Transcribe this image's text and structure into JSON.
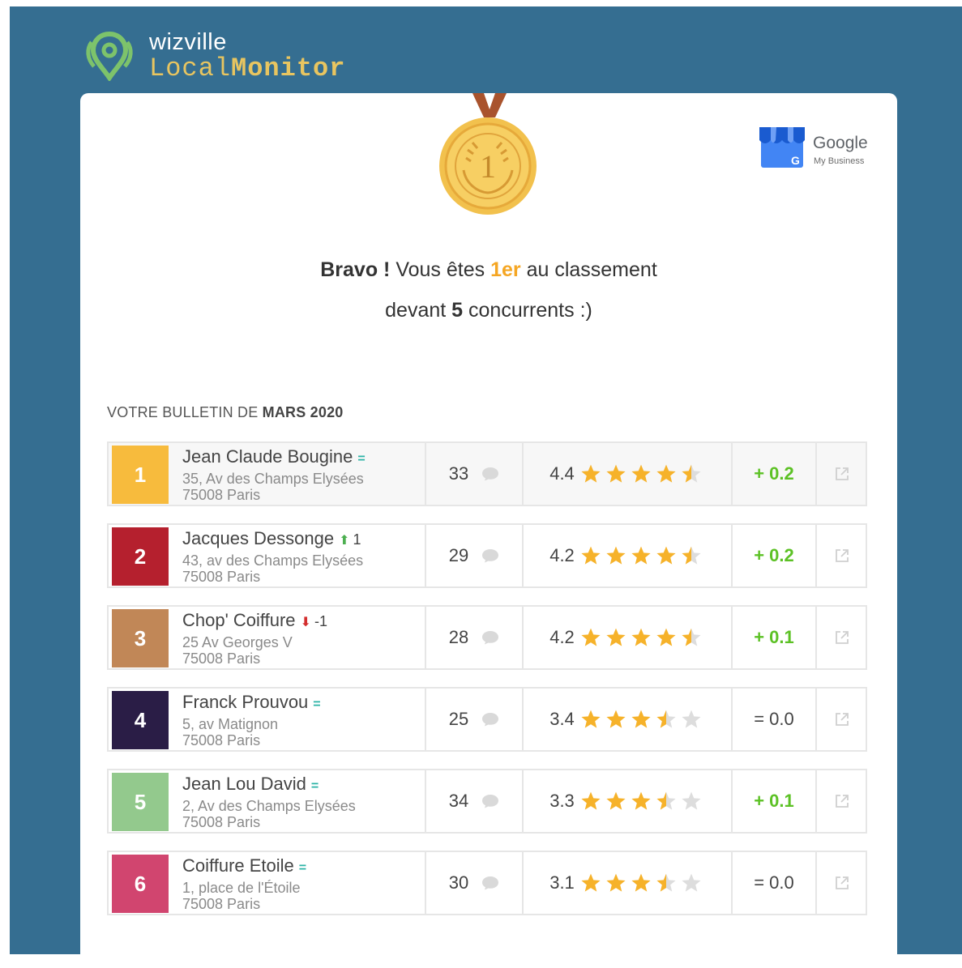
{
  "brand": {
    "top": "wizville",
    "bottom_light": "Local",
    "bottom_bold": "Monitor"
  },
  "gmb": {
    "word": "Google",
    "sub": "My Business"
  },
  "medal": {
    "number": "1"
  },
  "headline": {
    "line1_bold": "Bravo !",
    "line1_mid": " Vous êtes ",
    "line1_rank": "1er",
    "line1_end": " au classement",
    "line2_start": "devant ",
    "line2_count": "5",
    "line2_end": " concurrents :)"
  },
  "bulletin": {
    "prefix": "VOTRE BULLETIN DE ",
    "period": "MARS 2020"
  },
  "colors": {
    "frame": "#356e91",
    "gold": "#f5a623",
    "positive": "#5cc125",
    "star": "#f6b22a"
  },
  "rows": [
    {
      "rank": "1",
      "color": "#f7bb3d",
      "name": "Jean Claude Bougine",
      "trend_symbol": "=",
      "trend_kind": "eq",
      "trend_value": "",
      "addr1": "35, Av des Champs Elysées",
      "addr2": "75008 Paris",
      "reviews": "33",
      "rating": "4.4",
      "stars": 4.5,
      "delta": "+ 0.2",
      "delta_kind": "pos"
    },
    {
      "rank": "2",
      "color": "#b5202e",
      "name": "Jacques Dessonge",
      "trend_symbol": "⬆",
      "trend_kind": "up",
      "trend_value": "1",
      "addr1": "43, av des Champs Elysées",
      "addr2": "75008 Paris",
      "reviews": "29",
      "rating": "4.2",
      "stars": 4.5,
      "delta": "+ 0.2",
      "delta_kind": "pos"
    },
    {
      "rank": "3",
      "color": "#c18757",
      "name": "Chop' Coiffure",
      "trend_symbol": "⬇",
      "trend_kind": "down",
      "trend_value": "-1",
      "addr1": "25 Av Georges V",
      "addr2": "75008 Paris",
      "reviews": "28",
      "rating": "4.2",
      "stars": 4.5,
      "delta": "+ 0.1",
      "delta_kind": "pos"
    },
    {
      "rank": "4",
      "color": "#2a1d46",
      "name": "Franck Prouvou",
      "trend_symbol": "=",
      "trend_kind": "eq",
      "trend_value": "",
      "addr1": "5, av Matignon",
      "addr2": "75008 Paris",
      "reviews": "25",
      "rating": "3.4",
      "stars": 3.5,
      "delta": "= 0.0",
      "delta_kind": "zero"
    },
    {
      "rank": "5",
      "color": "#93c98d",
      "name": "Jean Lou David",
      "trend_symbol": "=",
      "trend_kind": "eq",
      "trend_value": "",
      "addr1": "2, Av des Champs Elysées",
      "addr2": "75008 Paris",
      "reviews": "34",
      "rating": "3.3",
      "stars": 3.5,
      "delta": "+ 0.1",
      "delta_kind": "pos"
    },
    {
      "rank": "6",
      "color": "#d1456f",
      "name": "Coiffure Etoile",
      "trend_symbol": "=",
      "trend_kind": "eq",
      "trend_value": "",
      "addr1": "1, place de l'Étoile",
      "addr2": "75008 Paris",
      "reviews": "30",
      "rating": "3.1",
      "stars": 3.5,
      "delta": "= 0.0",
      "delta_kind": "zero"
    }
  ]
}
